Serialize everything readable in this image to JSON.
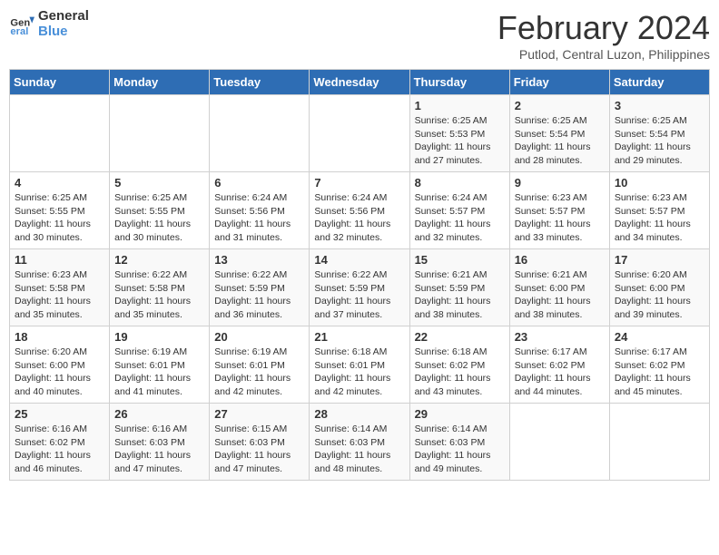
{
  "logo": {
    "general": "General",
    "blue": "Blue"
  },
  "header": {
    "title": "February 2024",
    "subtitle": "Putlod, Central Luzon, Philippines"
  },
  "days_of_week": [
    "Sunday",
    "Monday",
    "Tuesday",
    "Wednesday",
    "Thursday",
    "Friday",
    "Saturday"
  ],
  "weeks": [
    [
      {
        "day": "",
        "info": ""
      },
      {
        "day": "",
        "info": ""
      },
      {
        "day": "",
        "info": ""
      },
      {
        "day": "",
        "info": ""
      },
      {
        "day": "1",
        "info": "Sunrise: 6:25 AM\nSunset: 5:53 PM\nDaylight: 11 hours and 27 minutes."
      },
      {
        "day": "2",
        "info": "Sunrise: 6:25 AM\nSunset: 5:54 PM\nDaylight: 11 hours and 28 minutes."
      },
      {
        "day": "3",
        "info": "Sunrise: 6:25 AM\nSunset: 5:54 PM\nDaylight: 11 hours and 29 minutes."
      }
    ],
    [
      {
        "day": "4",
        "info": "Sunrise: 6:25 AM\nSunset: 5:55 PM\nDaylight: 11 hours and 30 minutes."
      },
      {
        "day": "5",
        "info": "Sunrise: 6:25 AM\nSunset: 5:55 PM\nDaylight: 11 hours and 30 minutes."
      },
      {
        "day": "6",
        "info": "Sunrise: 6:24 AM\nSunset: 5:56 PM\nDaylight: 11 hours and 31 minutes."
      },
      {
        "day": "7",
        "info": "Sunrise: 6:24 AM\nSunset: 5:56 PM\nDaylight: 11 hours and 32 minutes."
      },
      {
        "day": "8",
        "info": "Sunrise: 6:24 AM\nSunset: 5:57 PM\nDaylight: 11 hours and 32 minutes."
      },
      {
        "day": "9",
        "info": "Sunrise: 6:23 AM\nSunset: 5:57 PM\nDaylight: 11 hours and 33 minutes."
      },
      {
        "day": "10",
        "info": "Sunrise: 6:23 AM\nSunset: 5:57 PM\nDaylight: 11 hours and 34 minutes."
      }
    ],
    [
      {
        "day": "11",
        "info": "Sunrise: 6:23 AM\nSunset: 5:58 PM\nDaylight: 11 hours and 35 minutes."
      },
      {
        "day": "12",
        "info": "Sunrise: 6:22 AM\nSunset: 5:58 PM\nDaylight: 11 hours and 35 minutes."
      },
      {
        "day": "13",
        "info": "Sunrise: 6:22 AM\nSunset: 5:59 PM\nDaylight: 11 hours and 36 minutes."
      },
      {
        "day": "14",
        "info": "Sunrise: 6:22 AM\nSunset: 5:59 PM\nDaylight: 11 hours and 37 minutes."
      },
      {
        "day": "15",
        "info": "Sunrise: 6:21 AM\nSunset: 5:59 PM\nDaylight: 11 hours and 38 minutes."
      },
      {
        "day": "16",
        "info": "Sunrise: 6:21 AM\nSunset: 6:00 PM\nDaylight: 11 hours and 38 minutes."
      },
      {
        "day": "17",
        "info": "Sunrise: 6:20 AM\nSunset: 6:00 PM\nDaylight: 11 hours and 39 minutes."
      }
    ],
    [
      {
        "day": "18",
        "info": "Sunrise: 6:20 AM\nSunset: 6:00 PM\nDaylight: 11 hours and 40 minutes."
      },
      {
        "day": "19",
        "info": "Sunrise: 6:19 AM\nSunset: 6:01 PM\nDaylight: 11 hours and 41 minutes."
      },
      {
        "day": "20",
        "info": "Sunrise: 6:19 AM\nSunset: 6:01 PM\nDaylight: 11 hours and 42 minutes."
      },
      {
        "day": "21",
        "info": "Sunrise: 6:18 AM\nSunset: 6:01 PM\nDaylight: 11 hours and 42 minutes."
      },
      {
        "day": "22",
        "info": "Sunrise: 6:18 AM\nSunset: 6:02 PM\nDaylight: 11 hours and 43 minutes."
      },
      {
        "day": "23",
        "info": "Sunrise: 6:17 AM\nSunset: 6:02 PM\nDaylight: 11 hours and 44 minutes."
      },
      {
        "day": "24",
        "info": "Sunrise: 6:17 AM\nSunset: 6:02 PM\nDaylight: 11 hours and 45 minutes."
      }
    ],
    [
      {
        "day": "25",
        "info": "Sunrise: 6:16 AM\nSunset: 6:02 PM\nDaylight: 11 hours and 46 minutes."
      },
      {
        "day": "26",
        "info": "Sunrise: 6:16 AM\nSunset: 6:03 PM\nDaylight: 11 hours and 47 minutes."
      },
      {
        "day": "27",
        "info": "Sunrise: 6:15 AM\nSunset: 6:03 PM\nDaylight: 11 hours and 47 minutes."
      },
      {
        "day": "28",
        "info": "Sunrise: 6:14 AM\nSunset: 6:03 PM\nDaylight: 11 hours and 48 minutes."
      },
      {
        "day": "29",
        "info": "Sunrise: 6:14 AM\nSunset: 6:03 PM\nDaylight: 11 hours and 49 minutes."
      },
      {
        "day": "",
        "info": ""
      },
      {
        "day": "",
        "info": ""
      }
    ]
  ]
}
